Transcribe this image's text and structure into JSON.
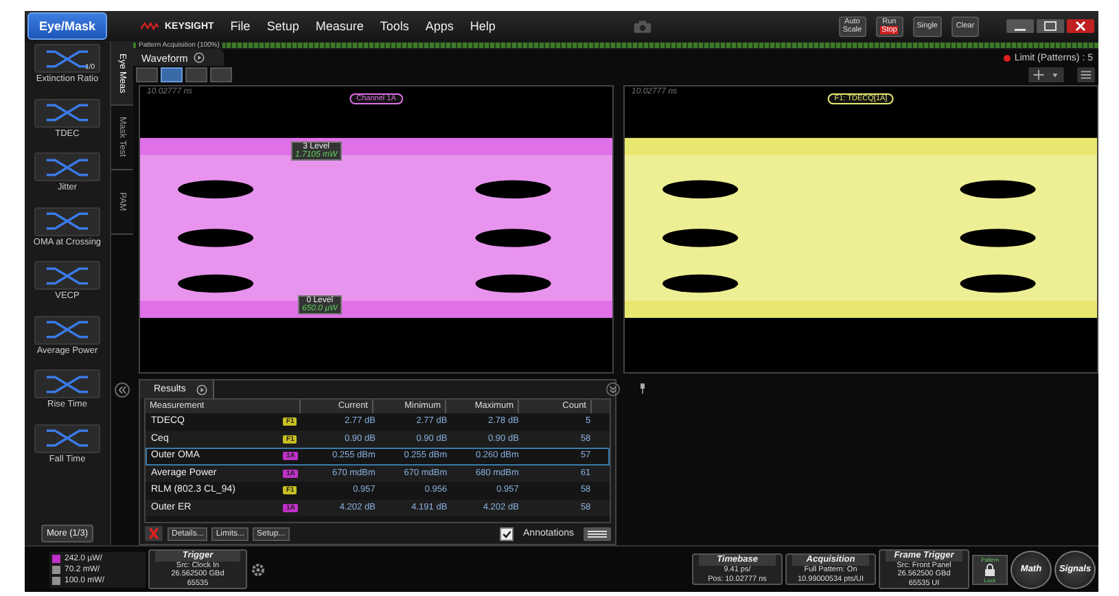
{
  "app_button": "Eye/Mask",
  "brand": "KEYSIGHT",
  "menu": [
    "File",
    "Setup",
    "Measure",
    "Tools",
    "Apps",
    "Help"
  ],
  "run_controls": [
    {
      "lines": [
        "Auto",
        "Scale"
      ],
      "kind": "plain"
    },
    {
      "lines": [
        "Run",
        "Stop"
      ],
      "kind": "run"
    },
    {
      "lines": [
        "Single"
      ],
      "kind": "plain"
    },
    {
      "lines": [
        "Clear"
      ],
      "kind": "plain"
    }
  ],
  "acquisition_status": {
    "label": "Pattern Acquisition (100%)",
    "level": 1
  },
  "waveform_tab": "Waveform",
  "limit_status": "Limit (Patterns) : 5",
  "layout_buttons": [
    {
      "selected": false
    },
    {
      "selected": true
    },
    {
      "selected": false
    },
    {
      "selected": false
    }
  ],
  "side_tabs": [
    {
      "label": "Eye Meas",
      "selected": true
    },
    {
      "label": "Mask Test",
      "selected": false
    },
    {
      "label": "PAM",
      "selected": false
    }
  ],
  "sidebar": {
    "items": [
      {
        "label": "Extinction Ratio",
        "icon_label": "1/0"
      },
      {
        "label": "TDEC"
      },
      {
        "label": "Jitter"
      },
      {
        "label": "OMA at Crossing"
      },
      {
        "label": "VECP"
      },
      {
        "label": "Average Power"
      },
      {
        "label": "Rise Time"
      },
      {
        "label": "Fall Time"
      }
    ],
    "more_button": "More (1/3)"
  },
  "panels": [
    {
      "time": "10.02777 ns",
      "label": "Channel 1A",
      "color": "#e070e8",
      "markers": [
        {
          "title": "3 Level",
          "value": "1.7105 mW"
        },
        {
          "title": "0 Level",
          "value": "650.0 µW"
        }
      ]
    },
    {
      "time": "10.02777 ns",
      "label": "F1: TDECQ[1A]",
      "color": "#e8e870"
    }
  ],
  "results": {
    "tab": "Results",
    "columns": [
      "Measurement",
      "Current",
      "Minimum",
      "Maximum",
      "Count"
    ],
    "rows": [
      {
        "name": "TDECQ",
        "source": "F1",
        "color": "#c8c020",
        "current": "2.77 dB",
        "minimum": "2.77 dB",
        "maximum": "2.78 dB",
        "count": "5",
        "selected": false
      },
      {
        "name": "Ceq",
        "source": "F1",
        "color": "#c8c020",
        "current": "0.90 dB",
        "minimum": "0.90 dB",
        "maximum": "0.90 dB",
        "count": "58",
        "selected": false
      },
      {
        "name": "Outer OMA",
        "source": "1A",
        "color": "#c030c8",
        "current": "0.255 dBm",
        "minimum": "0.255 dBm",
        "maximum": "0.260 dBm",
        "count": "57",
        "selected": true
      },
      {
        "name": "Average Power",
        "source": "1A",
        "color": "#c030c8",
        "current": "670 mdBm",
        "minimum": "670 mdBm",
        "maximum": "680 mdBm",
        "count": "61",
        "selected": false
      },
      {
        "name": "RLM (802.3 CL_94)",
        "source": "F1",
        "color": "#c8c020",
        "current": "0.957",
        "minimum": "0.956",
        "maximum": "0.957",
        "count": "58",
        "selected": false
      },
      {
        "name": "Outer ER",
        "source": "1A",
        "color": "#c030c8",
        "current": "4.202 dB",
        "minimum": "4.191 dB",
        "maximum": "4.202 dB",
        "count": "58",
        "selected": false
      }
    ],
    "buttons": [
      "Details...",
      "Limits...",
      "Setup..."
    ],
    "annotations": {
      "label": "Annotations",
      "checked": true
    }
  },
  "scales": [
    {
      "value": "242.0 µW/",
      "color": "#c030c8"
    },
    {
      "value": "70.2 mW/",
      "color": "#909090"
    },
    {
      "value": "100.0 mW/",
      "color": "#909090"
    }
  ],
  "trigger": {
    "title": "Trigger",
    "lines": [
      "Src: Clock In",
      "26.562500 GBd",
      "65535"
    ]
  },
  "info_boxes": [
    {
      "title": "Timebase",
      "lines": [
        "9.41 ps/",
        "Pos: 10.02777 ns"
      ]
    },
    {
      "title": "Acquisition",
      "lines": [
        "Full Pattern: On",
        "10.99000534 pts/UI"
      ]
    },
    {
      "title": "Frame Trigger",
      "lines": [
        "Src: Front Panel",
        "26.562500 GBd",
        "65535 UI"
      ]
    }
  ],
  "pattern_lock": {
    "top": "Pattern",
    "bottom": "Lock"
  },
  "round_buttons": [
    "Math",
    "Signals"
  ]
}
